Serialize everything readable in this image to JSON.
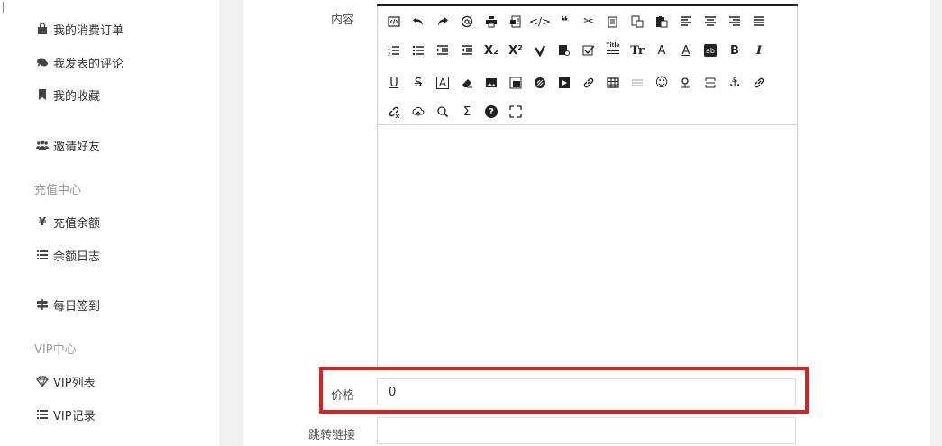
{
  "sidebar": {
    "items": [
      {
        "label": "我的消费订单",
        "icon": "shopping-bag-icon"
      },
      {
        "label": "我发表的评论",
        "icon": "comments-icon"
      },
      {
        "label": "我的收藏",
        "icon": "bookmark-icon"
      },
      {
        "label": "邀请好友",
        "icon": "users-icon"
      },
      {
        "label": "充值余额",
        "icon": "yen-icon"
      },
      {
        "label": "余额日志",
        "icon": "list-icon"
      },
      {
        "label": "每日签到",
        "icon": "signpost-icon"
      },
      {
        "label": "VIP列表",
        "icon": "diamond-icon"
      },
      {
        "label": "VIP记录",
        "icon": "list-icon"
      }
    ],
    "sections": {
      "recharge": "充值中心",
      "vip": "VIP中心"
    }
  },
  "form": {
    "content_label": "内容",
    "price_label": "价格",
    "price_value": "0",
    "redirect_label": "跳转链接",
    "redirect_value": ""
  },
  "toolbar": {
    "icons": [
      "source-code-icon",
      "undo-icon",
      "redo-icon",
      "anchor-at-icon",
      "print-icon",
      "preview-icon",
      "code-icon",
      "blockquote-icon",
      "cut-icon",
      "copy-icon",
      "paste-text-icon",
      "paste-icon",
      "align-left-icon",
      "align-center-icon",
      "align-right-icon",
      "align-justify-icon",
      "ordered-list-icon",
      "unordered-list-icon",
      "indent-icon",
      "outdent-icon",
      "subscript-icon",
      "superscript-icon",
      "clear-format-icon",
      "select-all-icon",
      "checklist-icon",
      "title-icon",
      "font-size-icon",
      "font-family-icon",
      "font-color-icon",
      "background-color-icon",
      "bold-icon",
      "italic-icon",
      "underline-icon",
      "strikethrough-icon",
      "line-height-icon",
      "eraser-icon",
      "image-icon",
      "multi-image-icon",
      "flash-icon",
      "media-icon",
      "link-icon",
      "table-icon",
      "horizontal-rule-icon",
      "emoticon-icon",
      "baidu-map-icon",
      "page-break-icon",
      "anchor-icon",
      "unlink-icon",
      "unlink-x-icon",
      "cloud-upload-icon",
      "search-replace-icon",
      "formula-icon",
      "help-icon",
      "fullscreen-icon"
    ],
    "glyphs": {
      "subscript": "X₂",
      "superscript": "X²",
      "title": "Title",
      "font_size": "Tr",
      "font_family": "A",
      "font_color": "A",
      "bg_color": "ab",
      "bold": "B",
      "italic": "I",
      "underline": "U",
      "strike": "S",
      "line_height": "A",
      "formula": "Σ",
      "help": "?"
    }
  }
}
